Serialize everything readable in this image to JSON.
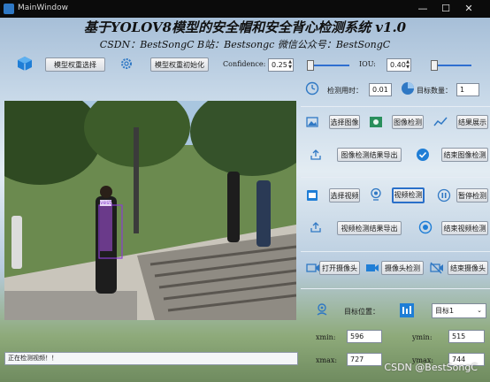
{
  "window": {
    "title": "MainWindow"
  },
  "header": {
    "title": "基于YOLOV8模型的安全帽和安全背心检测系统 v1.0",
    "subtitle": "CSDN：BestSongC   B站：Bestsongc   微信公众号：BestSongC"
  },
  "toolbar": {
    "model_select": "模型权重选择",
    "model_init": "模型权重初始化",
    "conf_label": "Confidence:",
    "conf_value": "0.25",
    "iou_label": "IOU:",
    "iou_value": "0.40"
  },
  "stats": {
    "time_label": "检测用时：",
    "time_value": "0.01",
    "count_label": "目标数量：",
    "count_value": "1"
  },
  "image_section": {
    "select_image": "选择图像",
    "image_detect": "图像检测",
    "show_result": "结果展示",
    "export_image": "图像检测结果导出",
    "end_image": "结束图像检测"
  },
  "video_section": {
    "select_video": "选择视频",
    "video_detect": "视频检测",
    "pause_detect": "暂停检测",
    "export_video": "视频检测结果导出",
    "end_video": "结束视频检测"
  },
  "camera_section": {
    "open_camera": "打开摄像头",
    "camera_detect": "摄像头检测",
    "close_camera": "结束摄像头"
  },
  "target": {
    "label": "目标位置：",
    "selected": "目标1",
    "xmin_label": "xmin:",
    "xmin": "596",
    "ymin_label": "ymin:",
    "ymin": "515",
    "xmax_label": "xmax:",
    "xmax": "727",
    "ymax_label": "ymax:",
    "ymax": "744"
  },
  "status_bar": {
    "text": "正在检测视频！！"
  },
  "detection": {
    "class_label": "vest"
  },
  "watermark": "CSDN @BestSongC",
  "colors": {
    "accent": "#2a70c9",
    "detect_box": "#8a3fd1"
  }
}
